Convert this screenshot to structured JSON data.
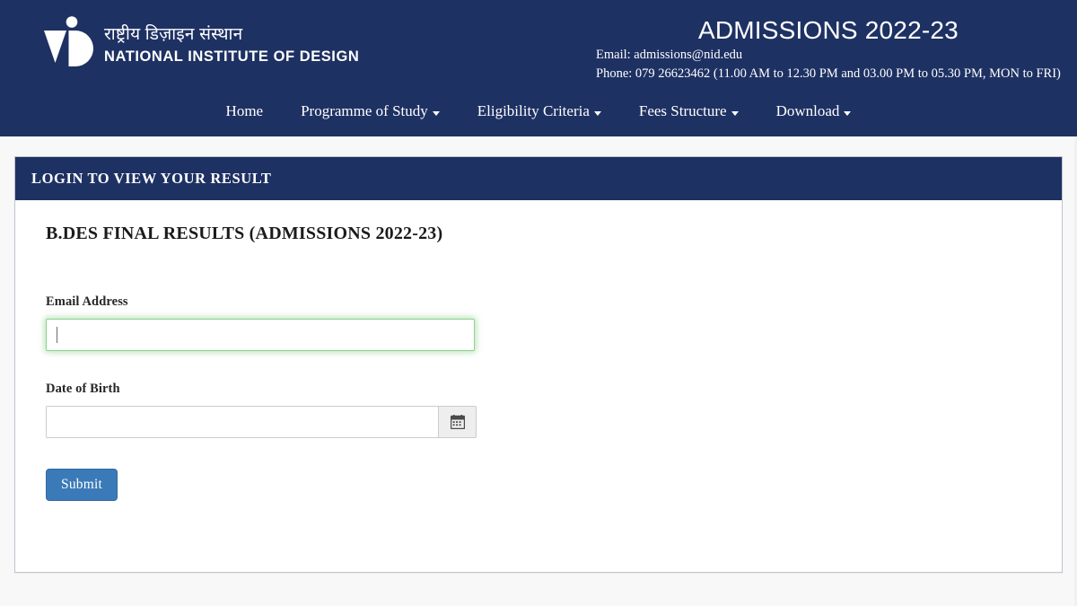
{
  "header": {
    "logo_icon": "nid-vd-monogram-logo",
    "brand_hindi": "राष्ट्रीय डिज़ाइन संस्थान",
    "brand_english": "NATIONAL INSTITUTE OF DESIGN",
    "admissions_title": "ADMISSIONS 2022-23",
    "email_line": "Email: admissions@nid.edu",
    "phone_line": "Phone: 079 26623462 (11.00 AM to 12.30 PM and 03.00 PM to 05.30 PM, MON to FRI)",
    "background_color": "#1e3163"
  },
  "nav": {
    "items": [
      {
        "label": "Home",
        "has_caret": false
      },
      {
        "label": "Programme of Study",
        "has_caret": true
      },
      {
        "label": "Eligibility Criteria",
        "has_caret": true
      },
      {
        "label": "Fees Structure",
        "has_caret": true
      },
      {
        "label": "Download",
        "has_caret": true
      }
    ]
  },
  "panel": {
    "heading": "LOGIN TO VIEW YOUR RESULT",
    "heading_background": "#1e3163",
    "section_title": "B.DES FINAL RESULTS (ADMISSIONS 2022-23)"
  },
  "form": {
    "email": {
      "label": "Email Address",
      "value": "",
      "placeholder": "",
      "focused": true,
      "focus_color": "#8fd18f"
    },
    "dob": {
      "label": "Date of Birth",
      "value": "",
      "placeholder": "",
      "calendar_icon": "calendar-icon"
    },
    "submit_label": "Submit",
    "submit_color": "#3a7ab8"
  }
}
